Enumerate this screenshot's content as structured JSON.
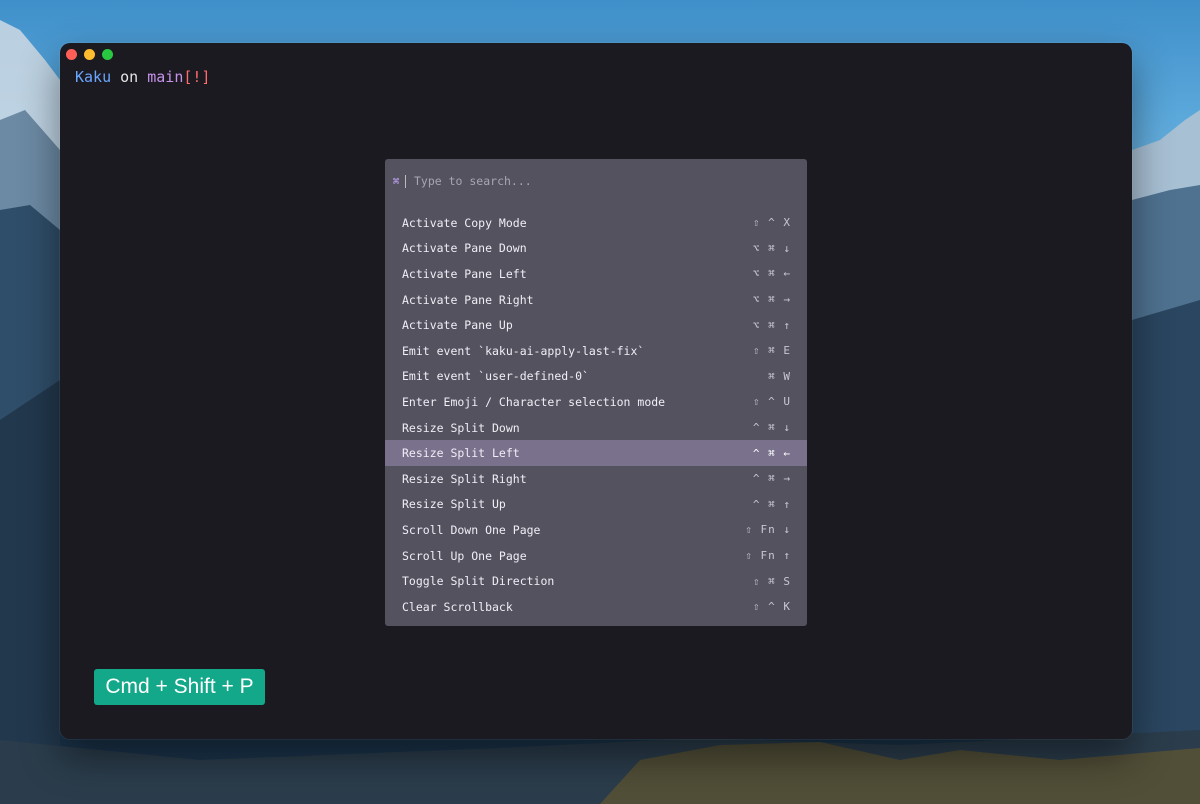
{
  "terminal": {
    "prompt": {
      "dir": "Kaku",
      "on": " on ",
      "branch_icon": "",
      "branch": "main",
      "status": "[!]"
    }
  },
  "palette": {
    "search_icon": "⌘",
    "placeholder": "Type to search...",
    "items": [
      {
        "label": "Activate Copy Mode",
        "keys": "⇧ ^ X"
      },
      {
        "label": "Activate Pane Down",
        "keys": "⌥ ⌘ ↓"
      },
      {
        "label": "Activate Pane Left",
        "keys": "⌥ ⌘ ←"
      },
      {
        "label": "Activate Pane Right",
        "keys": "⌥ ⌘ →"
      },
      {
        "label": "Activate Pane Up",
        "keys": "⌥ ⌘ ↑"
      },
      {
        "label": "Emit event `kaku-ai-apply-last-fix`",
        "keys": "⇧ ⌘ E"
      },
      {
        "label": "Emit event `user-defined-0`",
        "keys": "⌘ W"
      },
      {
        "label": "Enter Emoji / Character selection mode",
        "keys": "⇧ ^ U"
      },
      {
        "label": "Resize Split Down",
        "keys": "^ ⌘ ↓"
      },
      {
        "label": "Resize Split Left",
        "keys": "^ ⌘ ←",
        "selected": true
      },
      {
        "label": "Resize Split Right",
        "keys": "^ ⌘ →"
      },
      {
        "label": "Resize Split Up",
        "keys": "^ ⌘ ↑"
      },
      {
        "label": "Scroll Down One Page",
        "keys": "⇧ Fn ↓"
      },
      {
        "label": "Scroll Up One Page",
        "keys": "⇧ Fn ↑"
      },
      {
        "label": "Toggle Split Direction",
        "keys": "⇧ ⌘ S"
      },
      {
        "label": "Clear Scrollback",
        "keys": "⇧ ^ K"
      }
    ]
  },
  "badge": {
    "text": "Cmd + Shift + P"
  },
  "colors": {
    "window_bg": "#1b1a20",
    "palette_bg": "#55525f",
    "selected_bg": "#7a728d",
    "badge_bg": "#14a88a"
  }
}
